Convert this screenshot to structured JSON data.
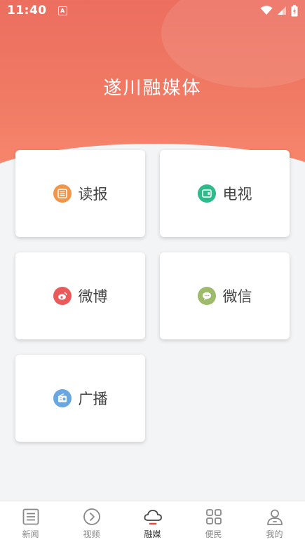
{
  "status": {
    "time": "11:40"
  },
  "header": {
    "title": "遂川融媒体"
  },
  "cards": [
    {
      "label": "读报",
      "icon": "newspaper-icon",
      "color": "#f0954a"
    },
    {
      "label": "电视",
      "icon": "tv-icon",
      "color": "#2fba8c"
    },
    {
      "label": "微博",
      "icon": "weibo-icon",
      "color": "#ea5a5a"
    },
    {
      "label": "微信",
      "icon": "wechat-icon",
      "color": "#9dbb6b"
    },
    {
      "label": "广播",
      "icon": "radio-icon",
      "color": "#6aa6e0"
    }
  ],
  "nav": {
    "items": [
      {
        "label": "新闻",
        "icon": "news-icon"
      },
      {
        "label": "视频",
        "icon": "video-play-icon"
      },
      {
        "label": "融媒",
        "icon": "cloud-icon",
        "active": true
      },
      {
        "label": "便民",
        "icon": "grid-icon"
      },
      {
        "label": "我的",
        "icon": "user-icon"
      }
    ]
  },
  "colors": {
    "accent": "#ec6e5f",
    "active_underline": "#e84a3c"
  }
}
